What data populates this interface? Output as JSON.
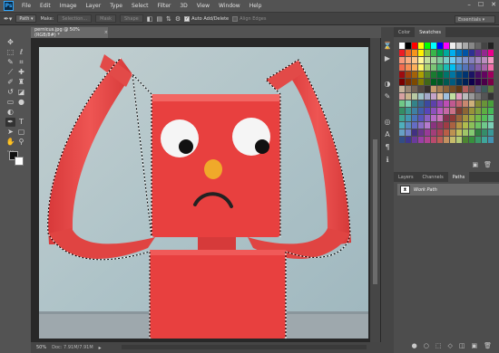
{
  "app": {
    "logo": "Ps"
  },
  "menu": [
    "File",
    "Edit",
    "Image",
    "Layer",
    "Type",
    "Select",
    "Filter",
    "3D",
    "View",
    "Window",
    "Help"
  ],
  "window_controls": [
    "–",
    "☐",
    "✕"
  ],
  "options_bar": {
    "mode_value": "Path",
    "make_label": "Make:",
    "selection_btn": "Selection...",
    "mask_btn": "Mask",
    "shape_btn": "Shape",
    "auto_add_delete": "Auto Add/Delete",
    "align_edges": "Align Edges",
    "workspace": "Essentials"
  },
  "document": {
    "tab_title": "pernicus.jpg @ 50% (RGB/8#) *",
    "close_glyph": "×",
    "zoom": "50%",
    "status": "Doc: 7.91M/7.91M"
  },
  "swatches_panel": {
    "tabs": [
      "Color",
      "Swatches"
    ],
    "active_tab": "Swatches"
  },
  "lower_panel": {
    "tabs": [
      "Layers",
      "Channels",
      "Paths"
    ],
    "active_tab": "Paths",
    "paths": [
      {
        "name": "Work Path"
      }
    ]
  },
  "colors": {
    "accent": "#31a8ff",
    "toy_red": "#e0413f",
    "background_blue": "#b8c9cc"
  },
  "icons": {
    "tools": [
      "move-icon",
      "marquee-icon",
      "lasso-icon",
      "quick-select-icon",
      "crop-icon",
      "eyedropper-icon",
      "healing-icon",
      "brush-icon",
      "stamp-icon",
      "history-brush-icon",
      "eraser-icon",
      "gradient-icon",
      "blur-icon",
      "dodge-icon",
      "pen-icon",
      "type-icon",
      "path-select-icon",
      "shape-icon",
      "hand-icon",
      "zoom-icon",
      "more-icon"
    ],
    "strip": [
      "history-icon",
      "actions-icon",
      "adjust-icon",
      "brush-panel-icon",
      "clone-source-icon",
      "character-icon",
      "paragraph-icon",
      "info-icon"
    ]
  }
}
